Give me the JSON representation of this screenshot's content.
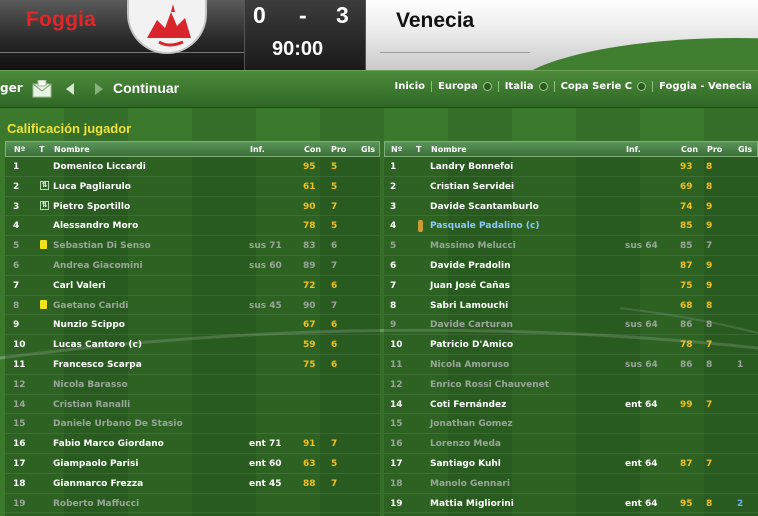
{
  "match": {
    "home_team": "Foggia",
    "away_team": "Venecia",
    "home_score": "0",
    "separator": "-",
    "away_score": "3",
    "clock": "90:00"
  },
  "nav": {
    "left_text": "ger",
    "continue_label": "Continuar",
    "breadcrumbs": [
      "Inicio",
      "Europa",
      "Italia",
      "Copa Serie C",
      "Foggia - Venecia"
    ]
  },
  "panel": {
    "title": "Calificación jugador",
    "columns": {
      "num": "Nº",
      "t": "T",
      "name": "Nombre",
      "inf": "Inf.",
      "con": "Con",
      "pro": "Pro",
      "gls": "Gls"
    }
  },
  "colors": {
    "home_red": "#e3262a",
    "title_yellow": "#f0e23a",
    "value_gold": "#f3c020",
    "link_blue": "#8cc8ff"
  },
  "home_players": [
    {
      "num": "1",
      "t": "",
      "name": "Domenico Liccardi",
      "inf": "",
      "con": "95",
      "pro": "5",
      "gls": "",
      "dim": false
    },
    {
      "num": "2",
      "t": "sub",
      "name": "Luca Pagliarulo",
      "inf": "",
      "con": "61",
      "pro": "5",
      "gls": "",
      "dim": false
    },
    {
      "num": "3",
      "t": "sub",
      "name": "Pietro Sportillo",
      "inf": "",
      "con": "90",
      "pro": "7",
      "gls": "",
      "dim": false
    },
    {
      "num": "4",
      "t": "",
      "name": "Alessandro Moro",
      "inf": "",
      "con": "78",
      "pro": "5",
      "gls": "",
      "dim": false
    },
    {
      "num": "5",
      "t": "card",
      "name": "Sebastian Di Senso",
      "inf": "sus 71",
      "con": "83",
      "pro": "6",
      "gls": "",
      "dim": true
    },
    {
      "num": "6",
      "t": "",
      "name": "Andrea Giacomini",
      "inf": "sus 60",
      "con": "89",
      "pro": "7",
      "gls": "",
      "dim": true
    },
    {
      "num": "7",
      "t": "",
      "name": "Carl Valeri",
      "inf": "",
      "con": "72",
      "pro": "6",
      "gls": "",
      "dim": false
    },
    {
      "num": "8",
      "t": "card",
      "name": "Gaetano Caridi",
      "inf": "sus 45",
      "con": "90",
      "pro": "7",
      "gls": "",
      "dim": true
    },
    {
      "num": "9",
      "t": "",
      "name": "Nunzio Scippo",
      "inf": "",
      "con": "67",
      "pro": "6",
      "gls": "",
      "dim": false
    },
    {
      "num": "10",
      "t": "",
      "name": "Lucas Cantoro (c)",
      "inf": "",
      "con": "59",
      "pro": "6",
      "gls": "",
      "dim": false
    },
    {
      "num": "11",
      "t": "",
      "name": "Francesco Scarpa",
      "inf": "",
      "con": "75",
      "pro": "6",
      "gls": "",
      "dim": false
    },
    {
      "num": "12",
      "t": "",
      "name": "Nicola Barasso",
      "inf": "",
      "con": "",
      "pro": "",
      "gls": "",
      "dim": true
    },
    {
      "num": "14",
      "t": "",
      "name": "Cristian Ranalli",
      "inf": "",
      "con": "",
      "pro": "",
      "gls": "",
      "dim": true
    },
    {
      "num": "15",
      "t": "",
      "name": "Daniele Urbano De Stasio",
      "inf": "",
      "con": "",
      "pro": "",
      "gls": "",
      "dim": true
    },
    {
      "num": "16",
      "t": "",
      "name": "Fabio Marco Giordano",
      "inf": "ent 71",
      "con": "91",
      "pro": "7",
      "gls": "",
      "dim": false
    },
    {
      "num": "17",
      "t": "",
      "name": "Giampaolo Parisi",
      "inf": "ent 60",
      "con": "63",
      "pro": "5",
      "gls": "",
      "dim": false
    },
    {
      "num": "18",
      "t": "",
      "name": "Gianmarco Frezza",
      "inf": "ent 45",
      "con": "88",
      "pro": "7",
      "gls": "",
      "dim": false
    },
    {
      "num": "19",
      "t": "",
      "name": "Roberto Maffucci",
      "inf": "",
      "con": "",
      "pro": "",
      "gls": "",
      "dim": true
    }
  ],
  "away_players": [
    {
      "num": "1",
      "t": "",
      "name": "Landry Bonnefoi",
      "inf": "",
      "con": "93",
      "pro": "8",
      "gls": "",
      "dim": false
    },
    {
      "num": "2",
      "t": "",
      "name": "Cristian Servidei",
      "inf": "",
      "con": "69",
      "pro": "8",
      "gls": "",
      "dim": false
    },
    {
      "num": "3",
      "t": "",
      "name": "Davide Scantamburlo",
      "inf": "",
      "con": "74",
      "pro": "9",
      "gls": "",
      "dim": false
    },
    {
      "num": "4",
      "t": "ball",
      "name": "Pasquale Padalino (c)",
      "inf": "",
      "con": "85",
      "pro": "9",
      "gls": "",
      "dim": false,
      "link": true
    },
    {
      "num": "5",
      "t": "",
      "name": "Massimo Melucci",
      "inf": "sus 64",
      "con": "85",
      "pro": "7",
      "gls": "",
      "dim": true
    },
    {
      "num": "6",
      "t": "",
      "name": "Davide Pradolin",
      "inf": "",
      "con": "87",
      "pro": "9",
      "gls": "",
      "dim": false
    },
    {
      "num": "7",
      "t": "",
      "name": "Juan José Cañas",
      "inf": "",
      "con": "75",
      "pro": "9",
      "gls": "",
      "dim": false
    },
    {
      "num": "8",
      "t": "",
      "name": "Sabri Lamouchi",
      "inf": "",
      "con": "68",
      "pro": "8",
      "gls": "",
      "dim": false
    },
    {
      "num": "9",
      "t": "",
      "name": "Davide Carturan",
      "inf": "sus 64",
      "con": "86",
      "pro": "8",
      "gls": "",
      "dim": true
    },
    {
      "num": "10",
      "t": "",
      "name": "Patricio D'Amico",
      "inf": "",
      "con": "78",
      "pro": "7",
      "gls": "",
      "dim": false
    },
    {
      "num": "11",
      "t": "",
      "name": "Nicola Amoruso",
      "inf": "sus 64",
      "con": "86",
      "pro": "8",
      "gls": "1",
      "dim": true
    },
    {
      "num": "12",
      "t": "",
      "name": "Enrico Rossi Chauvenet",
      "inf": "",
      "con": "",
      "pro": "",
      "gls": "",
      "dim": true
    },
    {
      "num": "14",
      "t": "",
      "name": "Coti Fernández",
      "inf": "ent 64",
      "con": "99",
      "pro": "7",
      "gls": "",
      "dim": false
    },
    {
      "num": "15",
      "t": "",
      "name": "Jonathan Gomez",
      "inf": "",
      "con": "",
      "pro": "",
      "gls": "",
      "dim": true
    },
    {
      "num": "16",
      "t": "",
      "name": "Lorenzo Meda",
      "inf": "",
      "con": "",
      "pro": "",
      "gls": "",
      "dim": true
    },
    {
      "num": "17",
      "t": "",
      "name": "Santiago Kuhl",
      "inf": "ent 64",
      "con": "87",
      "pro": "7",
      "gls": "",
      "dim": false
    },
    {
      "num": "18",
      "t": "",
      "name": "Manolo Gennari",
      "inf": "",
      "con": "",
      "pro": "",
      "gls": "",
      "dim": true
    },
    {
      "num": "19",
      "t": "",
      "name": "Mattia Migliorini",
      "inf": "ent 64",
      "con": "95",
      "pro": "8",
      "gls": "2",
      "dim": false
    }
  ]
}
